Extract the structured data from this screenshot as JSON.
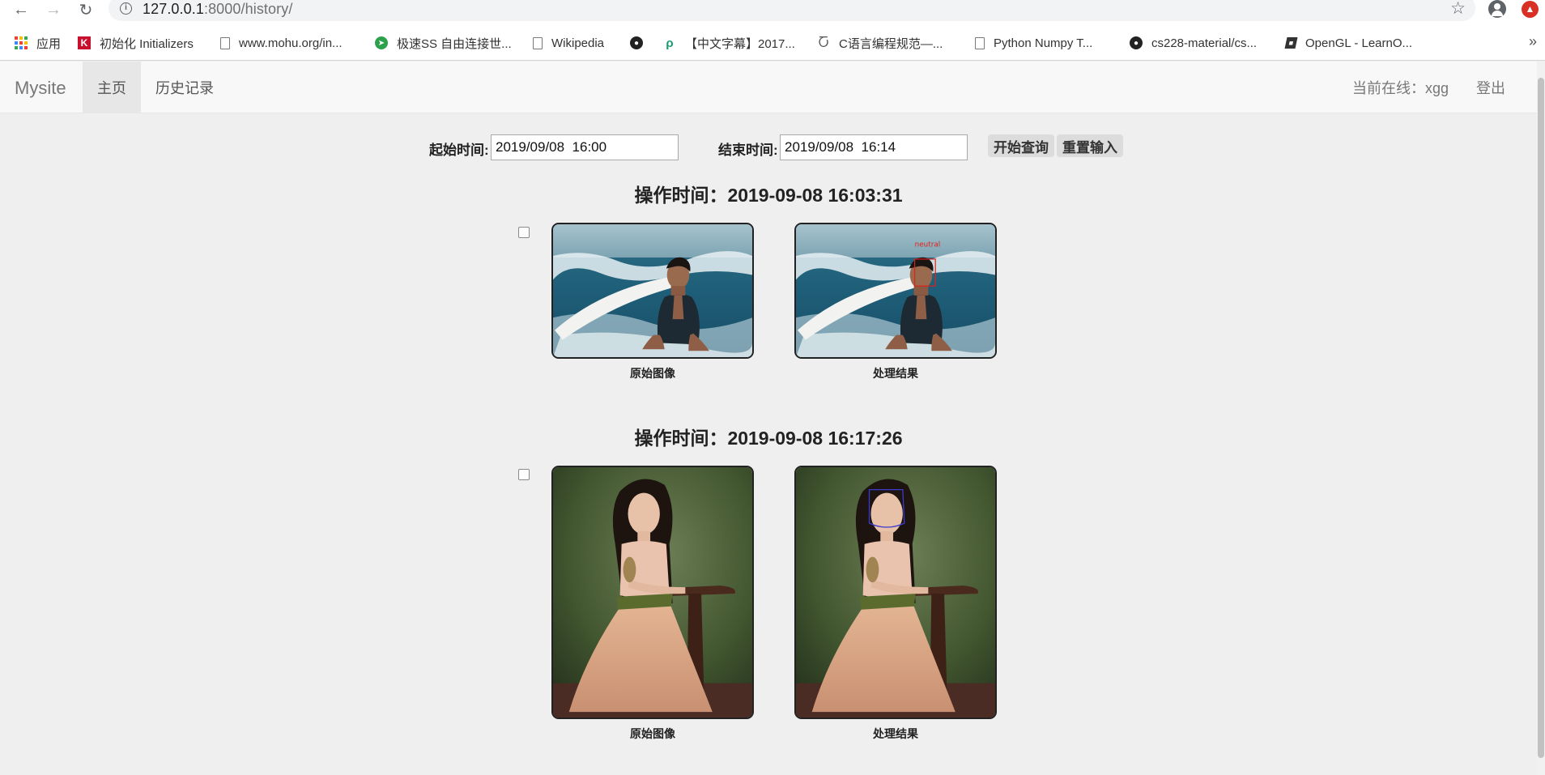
{
  "browser": {
    "url_host": "127.0.0.1",
    "url_path": ":8000/history/",
    "bookmarks": [
      {
        "label": "应用",
        "icon": "apps-grid-icon"
      },
      {
        "label": "初始化 Initializers",
        "icon": "k-logo-icon"
      },
      {
        "label": "www.mohu.org/in...",
        "icon": "page-icon"
      },
      {
        "label": "极速SS 自由连接世...",
        "icon": "paper-plane-icon"
      },
      {
        "label": "Wikipedia",
        "icon": "page-icon"
      },
      {
        "label": "",
        "icon": "github-icon"
      },
      {
        "label": "【中文字幕】2017...",
        "icon": "bilibili-icon"
      },
      {
        "label": "C语言编程规范—...",
        "icon": "c-logo-icon"
      },
      {
        "label": "Python Numpy T...",
        "icon": "page-icon"
      },
      {
        "label": "cs228-material/cs...",
        "icon": "github-icon"
      },
      {
        "label": "OpenGL - LearnO...",
        "icon": "book-icon"
      }
    ],
    "more": "»"
  },
  "site": {
    "brand": "Mysite",
    "nav": [
      {
        "label": "主页"
      },
      {
        "label": "历史记录"
      }
    ],
    "online_label": "当前在线：xgg",
    "logout_label": "登出"
  },
  "query": {
    "start_label": "起始时间:",
    "start_value": "2019/09/08  16:00",
    "end_label": "结束时间:",
    "end_value": "2019/09/08  16:14",
    "search_label": "开始查询",
    "reset_label": "重置输入"
  },
  "records": [
    {
      "title": "操作时间：2019-09-08 16:03:31",
      "original_caption": "原始图像",
      "result_caption": "处理结果",
      "face_label": "neutral"
    },
    {
      "title": "操作时间：2019-09-08 16:17:26",
      "original_caption": "原始图像",
      "result_caption": "处理结果"
    }
  ],
  "colors": {
    "background": "#efefef",
    "navbar": "#f8f8f8",
    "active_nav": "#e7e7e7",
    "detection_box_red": "#e0201c",
    "detection_box_blue": "#3a3ad0"
  }
}
